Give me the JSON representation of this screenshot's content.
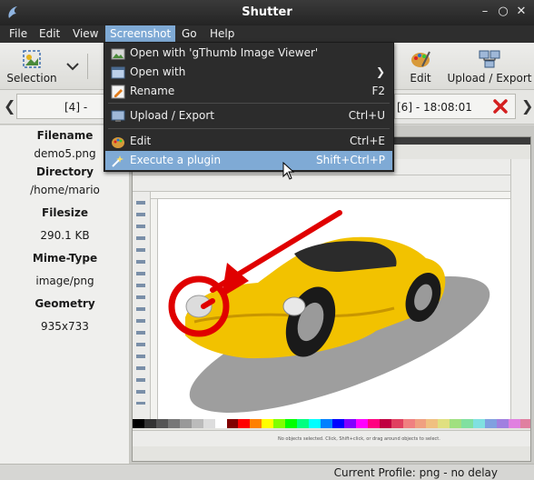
{
  "window": {
    "title": "Shutter"
  },
  "menubar": {
    "items": [
      {
        "label": "File",
        "mnemonic": "F"
      },
      {
        "label": "Edit",
        "mnemonic": "E"
      },
      {
        "label": "View",
        "mnemonic": "V"
      },
      {
        "label": "Screenshot",
        "mnemonic": "S"
      },
      {
        "label": "Go",
        "mnemonic": "G"
      },
      {
        "label": "Help",
        "mnemonic": "H"
      }
    ]
  },
  "toolbar": {
    "selection_label": "Selection",
    "edit_label": "Edit",
    "upload_label": "Upload / Export"
  },
  "session": {
    "left_tab": "[4] - 18:",
    "right_tab": "[6] - 18:08:01"
  },
  "info": {
    "filename_label": "Filename",
    "filename_value": "demo5.png",
    "directory_label": "Directory",
    "directory_value": "/home/mario",
    "filesize_label": "Filesize",
    "filesize_value": "290.1 KB",
    "mime_label": "Mime-Type",
    "mime_value": "image/png",
    "geometry_label": "Geometry",
    "geometry_value": "935x733"
  },
  "screenshot_menu": {
    "open_with_gthumb": "Open with 'gThumb Image Viewer'",
    "open_with": "Open with",
    "rename": "Rename",
    "rename_accel": "F2",
    "upload_export": "Upload / Export",
    "upload_export_accel": "Ctrl+U",
    "edit": "Edit",
    "edit_accel": "Ctrl+E",
    "execute_plugin": "Execute a plugin",
    "execute_plugin_accel": "Shift+Ctrl+P"
  },
  "inkscape": {
    "status_text": "No objects selected. Click, Shift+click, or drag around objects to select."
  },
  "statusbar": {
    "profile": "Current Profile: png - no delay"
  },
  "colors": {
    "menu_highlight": "#7faad5",
    "menu_bg": "#2c2c2c",
    "titlebar_bg": "#2e2e2e",
    "close_red": "#d42020",
    "car_yellow": "#f2c200",
    "annotation_red": "#e00000"
  }
}
